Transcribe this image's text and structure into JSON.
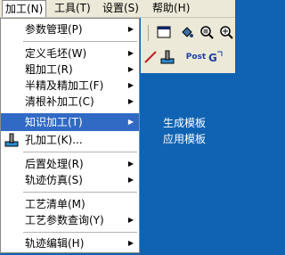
{
  "menubar": {
    "items": [
      {
        "label": "加工(N)"
      },
      {
        "label": "工具(T)"
      },
      {
        "label": "设置(S)"
      },
      {
        "label": "帮助(H)"
      }
    ]
  },
  "menu": {
    "items": [
      {
        "label": "参数管理(P)",
        "arrow": "▶"
      },
      {
        "label": "定义毛坯(W)",
        "arrow": "▶"
      },
      {
        "label": "粗加工(R)",
        "arrow": "▶"
      },
      {
        "label": "半精及精加工(F)",
        "arrow": "▶"
      },
      {
        "label": "清根补加工(C)",
        "arrow": "▶"
      },
      {
        "label": "知识加工(T)",
        "arrow": "▶"
      },
      {
        "label": "孔加工(K)..."
      },
      {
        "label": "后置处理(R)",
        "arrow": "▶"
      },
      {
        "label": "轨迹仿真(S)",
        "arrow": "▶"
      },
      {
        "label": "工艺清单(M)"
      },
      {
        "label": "工艺参数查询(Y)",
        "arrow": "▶"
      },
      {
        "label": "轨迹编辑(H)",
        "arrow": "▶"
      }
    ]
  },
  "submenu": {
    "items": [
      {
        "label": "生成模板"
      },
      {
        "label": "应用模板"
      }
    ]
  },
  "toolbar": {
    "post_label": "Post"
  },
  "colors": {
    "highlight": "#316ac5",
    "background": "#1063b3",
    "menu_bg": "#ffffff",
    "bar_bg": "#ece9d8"
  }
}
